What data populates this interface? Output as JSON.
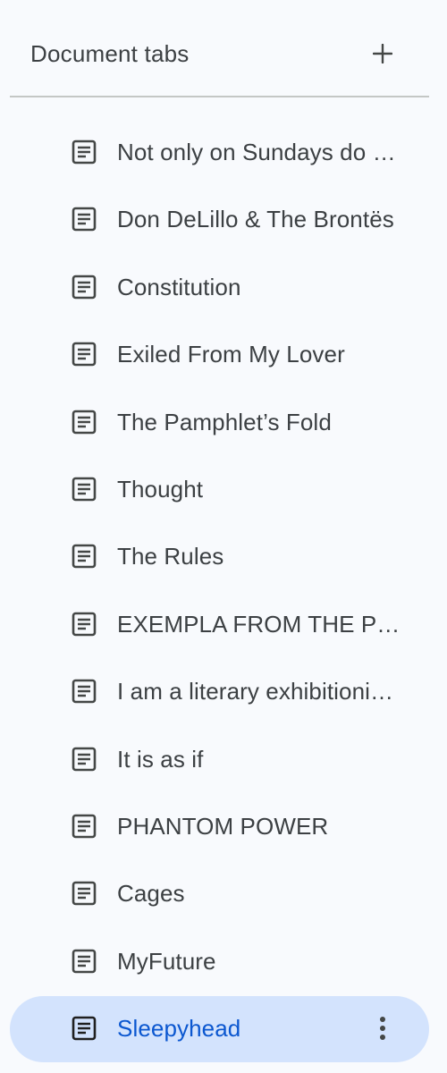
{
  "header": {
    "title": "Document tabs",
    "add_icon": "plus-icon"
  },
  "tabs": [
    {
      "label": "Not only on Sundays do …",
      "icon": "document-icon",
      "active": false
    },
    {
      "label": "Don DeLillo & The Brontës",
      "icon": "document-icon",
      "active": false
    },
    {
      "label": "Constitution",
      "icon": "document-icon",
      "active": false
    },
    {
      "label": "Exiled From My Lover",
      "icon": "document-icon",
      "active": false
    },
    {
      "label": "The Pamphlet’s Fold",
      "icon": "document-icon",
      "active": false
    },
    {
      "label": "Thought",
      "icon": "document-icon",
      "active": false
    },
    {
      "label": "The Rules",
      "icon": "document-icon",
      "active": false
    },
    {
      "label": "EXEMPLA FROM THE PH…",
      "icon": "document-icon",
      "active": false
    },
    {
      "label": "I am a literary exhibitioni…",
      "icon": "document-icon",
      "active": false
    },
    {
      "label": "It is as if",
      "icon": "document-icon",
      "active": false
    },
    {
      "label": "PHANTOM POWER",
      "icon": "document-icon",
      "active": false
    },
    {
      "label": "Cages",
      "icon": "document-icon",
      "active": false
    },
    {
      "label": "MyFuture",
      "icon": "document-icon",
      "active": false
    },
    {
      "label": "Sleepyhead",
      "icon": "document-icon",
      "active": true,
      "menu_icon": "more-vertical-icon"
    }
  ],
  "colors": {
    "background": "#f8fafd",
    "active_background": "#d3e3fd",
    "active_text": "#0b57d0",
    "text": "#3c4043",
    "divider": "#c4c7c5"
  }
}
